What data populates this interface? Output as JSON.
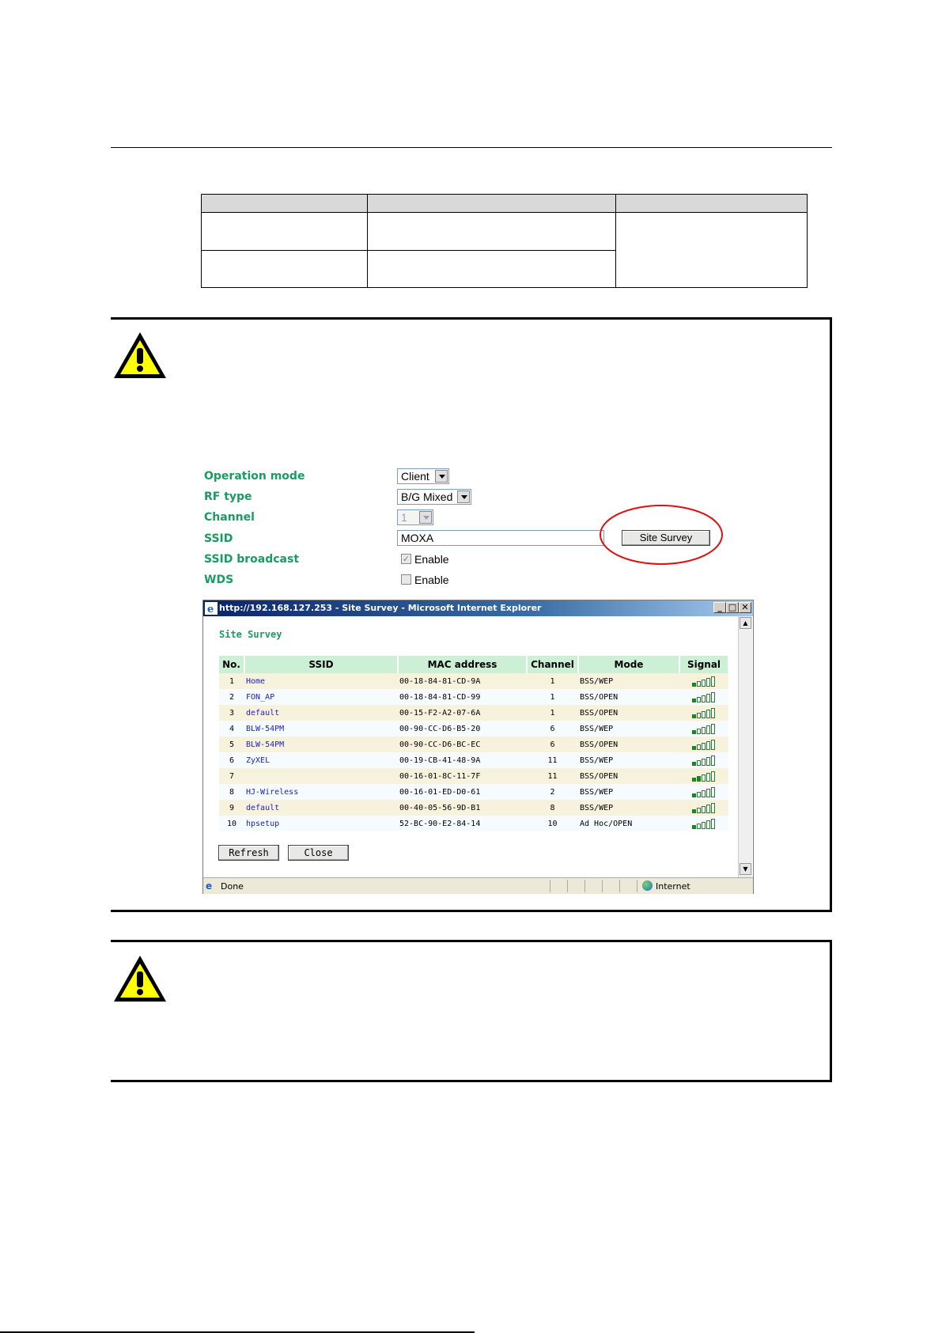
{
  "settings_form": {
    "operation_mode": {
      "label": "Operation mode",
      "value": "Client"
    },
    "rf_type": {
      "label": "RF type",
      "value": "B/G Mixed"
    },
    "channel": {
      "label": "Channel",
      "value": "1"
    },
    "ssid": {
      "label": "SSID",
      "value": "MOXA"
    },
    "site_survey_button": "Site Survey",
    "ssid_broadcast": {
      "label": "SSID broadcast",
      "checkbox_label": "Enable",
      "checked": true
    },
    "wds": {
      "label": "WDS",
      "checkbox_label": "Enable",
      "checked": false
    }
  },
  "ie_window": {
    "title": "http://192.168.127.253 - Site Survey - Microsoft Internet Explorer",
    "heading": "Site Survey",
    "columns": [
      "No.",
      "SSID",
      "MAC address",
      "Channel",
      "Mode",
      "Signal"
    ],
    "rows": [
      {
        "no": "1",
        "ssid": "Home",
        "mac": "00-18-84-81-CD-9A",
        "channel": "1",
        "mode": "BSS/WEP"
      },
      {
        "no": "2",
        "ssid": "FON_AP",
        "mac": "00-18-84-81-CD-99",
        "channel": "1",
        "mode": "BSS/OPEN"
      },
      {
        "no": "3",
        "ssid": "default",
        "mac": "00-15-F2-A2-07-6A",
        "channel": "1",
        "mode": "BSS/OPEN"
      },
      {
        "no": "4",
        "ssid": "BLW-54PM",
        "mac": "00-90-CC-D6-B5-20",
        "channel": "6",
        "mode": "BSS/WEP"
      },
      {
        "no": "5",
        "ssid": "BLW-54PM",
        "mac": "00-90-CC-D6-BC-EC",
        "channel": "6",
        "mode": "BSS/OPEN"
      },
      {
        "no": "6",
        "ssid": "ZyXEL",
        "mac": "00-19-CB-41-48-9A",
        "channel": "11",
        "mode": "BSS/WEP"
      },
      {
        "no": "7",
        "ssid": "",
        "mac": "00-16-01-8C-11-7F",
        "channel": "11",
        "mode": "BSS/OPEN"
      },
      {
        "no": "8",
        "ssid": "HJ-Wireless",
        "mac": "00-16-01-ED-D0-61",
        "channel": "2",
        "mode": "BSS/WEP"
      },
      {
        "no": "9",
        "ssid": "default",
        "mac": "00-40-05-56-9D-B1",
        "channel": "8",
        "mode": "BSS/WEP"
      },
      {
        "no": "10",
        "ssid": "hpsetup",
        "mac": "52-BC-90-E2-84-14",
        "channel": "10",
        "mode": "Ad Hoc/OPEN"
      }
    ],
    "refresh_button": "Refresh",
    "close_button": "Close",
    "status_left": "Done",
    "status_zone": "Internet"
  },
  "colors": {
    "form_label": "#1a9b62",
    "table_header": "#ccf0d6",
    "row_odd": "#f7f2dc",
    "row_even": "#f5fbff",
    "ssid_link": "#1c1ccc",
    "signal_bar": "#0a8f1c",
    "highlight_circle": "#e01010",
    "warning_yellow": "#ffff00"
  },
  "icons": [
    "warning-icon",
    "ie-logo-icon",
    "globe-icon",
    "minimize-icon",
    "maximize-icon",
    "close-icon",
    "scroll-up-icon",
    "scroll-down-icon",
    "signal-icon"
  ]
}
